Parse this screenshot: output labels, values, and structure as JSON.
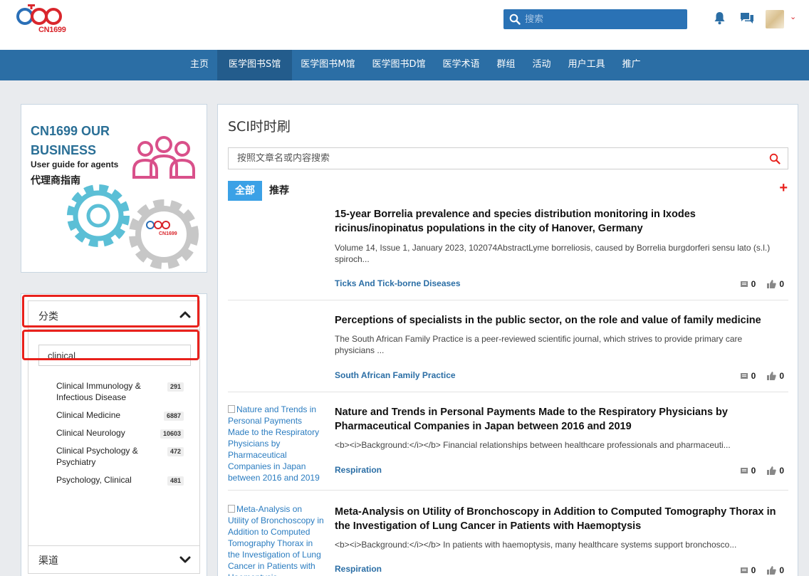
{
  "header": {
    "logo_text": "CN1699",
    "search_placeholder": "搜索"
  },
  "nav": {
    "items": [
      {
        "label": "主页",
        "active": false
      },
      {
        "label": "医学图书S馆",
        "active": true
      },
      {
        "label": "医学图书M馆",
        "active": false
      },
      {
        "label": "医学图书D馆",
        "active": false
      },
      {
        "label": "医学术语",
        "active": false
      },
      {
        "label": "群组",
        "active": false
      },
      {
        "label": "活动",
        "active": false
      },
      {
        "label": "用户工具",
        "active": false
      },
      {
        "label": "推广",
        "active": false
      }
    ]
  },
  "banner": {
    "line1": "CN1699 OUR",
    "line2": "BUSINESS",
    "line3": "User guide for agents",
    "line4": "代理商指南",
    "logo_text": "CN1699"
  },
  "sidebar": {
    "category_label": "分类",
    "category_filter_value": "clinical",
    "categories": [
      {
        "name": "Clinical Immunology & Infectious Disease",
        "count": "291"
      },
      {
        "name": "Clinical Medicine",
        "count": "6887"
      },
      {
        "name": "Clinical Neurology",
        "count": "10603"
      },
      {
        "name": "Clinical Psychology & Psychiatry",
        "count": "472"
      },
      {
        "name": "Psychology, Clinical",
        "count": "481"
      }
    ],
    "channel_label": "渠道"
  },
  "main": {
    "title": "SCI时时刷",
    "search_placeholder": "按照文章名或内容搜索",
    "tabs": {
      "all": "全部",
      "recommended": "推荐"
    },
    "articles": [
      {
        "thumb_alt": "",
        "title": "15-year Borrelia prevalence and species distribution monitoring in Ixodes ricinus/inopinatus populations in the city of Hanover, Germany",
        "abstract": "Volume 14, Issue 1, January 2023, 102074AbstractLyme borreliosis, caused by Borrelia burgdorferi sensu lato (s.l.) spiroch...",
        "journal": "Ticks And Tick-borne Diseases",
        "comments": "0",
        "likes": "0"
      },
      {
        "thumb_alt": "",
        "title": "Perceptions of specialists in the public sector, on the role and value of family medicine",
        "abstract": "The South African Family Practice is a peer-reviewed scientific journal, which strives to provide primary care physicians ...",
        "journal": "South African Family Practice",
        "comments": "0",
        "likes": "0"
      },
      {
        "thumb_alt": "Nature and Trends in Personal Payments Made to the Respiratory Physicians by Pharmaceutical Companies in Japan between 2016 and 2019",
        "title": "Nature and Trends in Personal Payments Made to the Respiratory Physicians by Pharmaceutical Companies in Japan between 2016 and 2019",
        "abstract": "<b><i>Background:</i></b> Financial relationships between healthcare professionals and pharmaceuti...",
        "journal": "Respiration",
        "comments": "0",
        "likes": "0"
      },
      {
        "thumb_alt": "Meta-Analysis on Utility of Bronchoscopy in Addition to Computed Tomography Thorax in the Investigation of Lung Cancer in Patients with Haemoptysis",
        "title": "Meta-Analysis on Utility of Bronchoscopy in Addition to Computed Tomography Thorax in the Investigation of Lung Cancer in Patients with Haemoptysis",
        "abstract": "<b><i>Background:</i></b> In patients with haemoptysis, many healthcare systems support bronchosco...",
        "journal": "Respiration",
        "comments": "0",
        "likes": "0"
      }
    ]
  },
  "colors": {
    "nav_bg": "#2b6ea5",
    "accent_blue": "#3ba1e6",
    "highlight_red": "#e8211c",
    "journal_link": "#2b6ea5"
  }
}
